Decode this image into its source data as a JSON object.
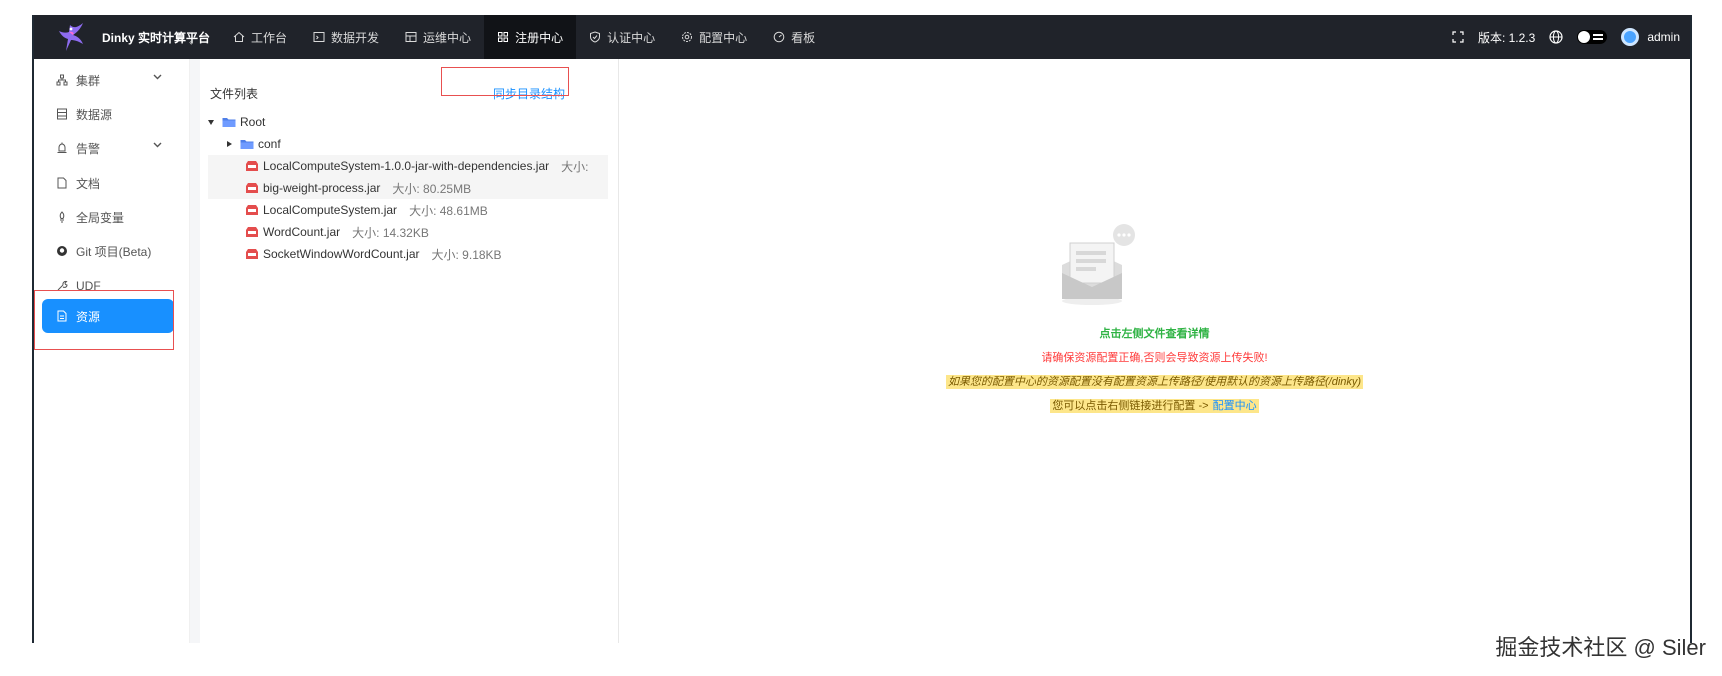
{
  "header": {
    "brand": "Dinky 实时计算平台",
    "nav": [
      {
        "label": "工作台",
        "icon": "home-icon"
      },
      {
        "label": "数据开发",
        "icon": "code-icon"
      },
      {
        "label": "运维中心",
        "icon": "monitor-icon"
      },
      {
        "label": "注册中心",
        "icon": "grid-icon",
        "active": true
      },
      {
        "label": "认证中心",
        "icon": "shield-icon"
      },
      {
        "label": "配置中心",
        "icon": "settings-icon"
      },
      {
        "label": "看板",
        "icon": "dashboard-icon"
      }
    ],
    "version_label": "版本: 1.2.3",
    "user": "admin"
  },
  "sidebar": {
    "items": [
      {
        "label": "集群",
        "icon": "cluster-icon",
        "expandable": true
      },
      {
        "label": "数据源",
        "icon": "database-icon"
      },
      {
        "label": "告警",
        "icon": "alert-icon",
        "expandable": true
      },
      {
        "label": "文档",
        "icon": "document-icon"
      },
      {
        "label": "全局变量",
        "icon": "variable-icon"
      },
      {
        "label": "Git 项目(Beta)",
        "icon": "github-icon"
      },
      {
        "label": "UDF",
        "icon": "tool-icon"
      },
      {
        "label": "资源",
        "icon": "resource-icon",
        "active": true
      }
    ]
  },
  "file_panel": {
    "title": "文件列表",
    "sync_button": "同步目录结构",
    "tree": {
      "root": "Root",
      "folder": "conf",
      "files": [
        {
          "name": "LocalComputeSystem-1.0.0-jar-with-dependencies.jar",
          "size": "大小:"
        },
        {
          "name": "big-weight-process.jar",
          "size": "大小: 80.25MB"
        },
        {
          "name": "LocalComputeSystem.jar",
          "size": "大小: 48.61MB"
        },
        {
          "name": "WordCount.jar",
          "size": "大小: 14.32KB"
        },
        {
          "name": "SocketWindowWordCount.jar",
          "size": "大小: 9.18KB"
        }
      ]
    }
  },
  "detail": {
    "hint": "点击左侧文件查看详情",
    "warning": "请确保资源配置正确,否则会导致资源上传失败!",
    "note": "如果您的配置中心的资源配置没有配置资源上传路径/使用默认的资源上传路径(/dinky)",
    "link_prefix": "您可以点击右侧链接进行配置 ->",
    "link_text": "配置中心"
  },
  "watermark": "掘金技术社区 @ Siler",
  "colors": {
    "header_bg": "#20232a",
    "accent": "#1890ff",
    "success": "#2fb344",
    "danger": "#ff3b3b",
    "highlight": "#fde68a"
  }
}
